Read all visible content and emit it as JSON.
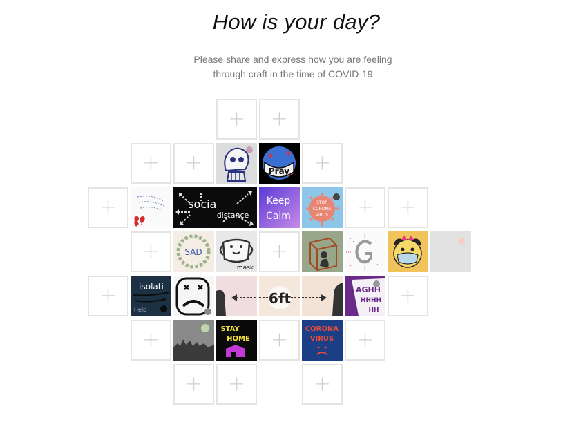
{
  "header": {
    "title": "How is your day?",
    "subtitle_line1": "Please share and express how you are feeling",
    "subtitle_line2": "through craft in the time of COVID-19"
  },
  "add_symbol": "+",
  "tiles": {
    "pray": {
      "text": "Pray"
    },
    "social_distance": {
      "text1": "social",
      "text2": "distance"
    },
    "keep_calm": {
      "text1": "Keep",
      "text2": "Calm"
    },
    "stop_corona": {
      "text1": "STOP",
      "text2": "CORONA",
      "text3": "VIRUS"
    },
    "sad": {
      "text": "SAD"
    },
    "mask": {
      "text": "mask"
    },
    "isolation": {
      "text1": "isolati",
      "text2": "Help"
    },
    "six_ft": {
      "text": "6ft"
    },
    "aghh": {
      "text1": "AGHH",
      "text2": "HHHH",
      "text3": "HH"
    },
    "stay_home": {
      "text1": "STAY",
      "text2": "HOME"
    },
    "corona_virus": {
      "text1": "CORONA",
      "text2": "VIRUS"
    }
  },
  "colors": {
    "empty_border": "#e4e4e4",
    "plus": "#cfcfcf",
    "placeholder_tile": "#e2e2e2"
  }
}
